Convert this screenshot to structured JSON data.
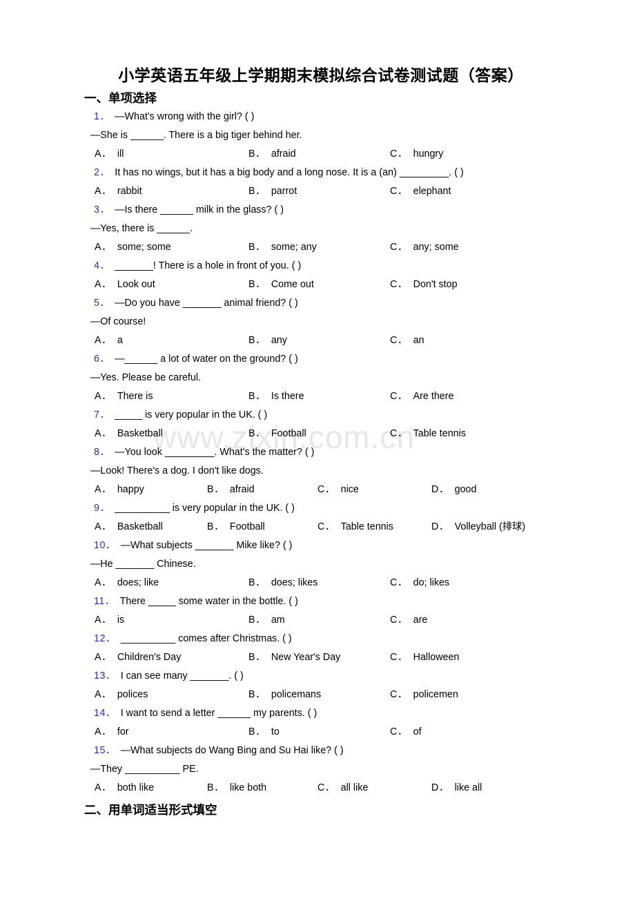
{
  "document": {
    "title": "小学英语五年级上学期期末模拟综合试卷测试题（答案）",
    "watermark": "www.zixin.com.cn",
    "accent_blue": "#2b2bc8"
  },
  "sections": [
    {
      "heading": "一、单项选择"
    },
    {
      "heading": "二、用单词适当形式填空"
    }
  ],
  "questions": [
    {
      "num": "1．",
      "stem": "—What's wrong with the girl? (    )",
      "cont": "—She is ______. There is a big tiger behind her.",
      "cols": 3,
      "options": [
        {
          "label": "A．",
          "text": "ill"
        },
        {
          "label": "B．",
          "text": "afraid"
        },
        {
          "label": "C．",
          "text": "hungry"
        }
      ]
    },
    {
      "num": "2．",
      "stem": "It has no wings, but it has a big body and a long nose. It is a (an) _________. (    )",
      "cont": "",
      "cols": 3,
      "options": [
        {
          "label": "A．",
          "text": "rabbit"
        },
        {
          "label": "B．",
          "text": "parrot"
        },
        {
          "label": "C．",
          "text": "elephant"
        }
      ]
    },
    {
      "num": "3．",
      "stem": "—Is there ______ milk in the glass? (    )",
      "cont": "—Yes, there is ______.",
      "cols": 3,
      "options": [
        {
          "label": "A．",
          "text": "some; some"
        },
        {
          "label": "B．",
          "text": "some; any"
        },
        {
          "label": "C．",
          "text": "any; some"
        }
      ]
    },
    {
      "num": "4．",
      "stem": "_______! There is a hole in front of you. (    )",
      "cont": "",
      "cols": 3,
      "options": [
        {
          "label": "A．",
          "text": "Look out"
        },
        {
          "label": "B．",
          "text": "Come out"
        },
        {
          "label": "C．",
          "text": "Don't stop"
        }
      ]
    },
    {
      "num": "5．",
      "stem": "—Do you have _______ animal friend? (    )",
      "cont": "—Of course!",
      "cols": 3,
      "options": [
        {
          "label": "A．",
          "text": "a"
        },
        {
          "label": "B．",
          "text": "any"
        },
        {
          "label": "C．",
          "text": "an"
        }
      ]
    },
    {
      "num": "6．",
      "stem": "—______ a lot of water on the ground? (    )",
      "cont": "—Yes. Please be careful.",
      "cols": 3,
      "options": [
        {
          "label": "A．",
          "text": "There is"
        },
        {
          "label": "B．",
          "text": "Is there"
        },
        {
          "label": "C．",
          "text": "Are there"
        }
      ]
    },
    {
      "num": "7．",
      "stem": "_____ is very popular in the UK. (    )",
      "cont": "",
      "cols": 3,
      "options": [
        {
          "label": "A．",
          "text": "Basketball"
        },
        {
          "label": "B．",
          "text": "Football"
        },
        {
          "label": "C．",
          "text": "Table tennis"
        }
      ]
    },
    {
      "num": "8．",
      "stem": "—You look _________. What's the matter? (    )",
      "cont": "—Look! There's a dog. I don't like dogs.",
      "cols": 4,
      "options": [
        {
          "label": "A．",
          "text": "happy"
        },
        {
          "label": "B．",
          "text": "afraid"
        },
        {
          "label": "C．",
          "text": "nice"
        },
        {
          "label": "D．",
          "text": "good"
        }
      ]
    },
    {
      "num": "9．",
      "stem": "__________ is very popular in the UK. (    )",
      "cont": "",
      "cols": 4,
      "options": [
        {
          "label": "A．",
          "text": "Basketball"
        },
        {
          "label": "B．",
          "text": "Football"
        },
        {
          "label": "C．",
          "text": "Table tennis"
        },
        {
          "label": "D．",
          "text": "Volleyball (排球)"
        }
      ]
    },
    {
      "num": "10．",
      "stem": "—What subjects _______ Mike like? (    )",
      "cont": "—He _______ Chinese.",
      "cols": 3,
      "options": [
        {
          "label": "A．",
          "text": "does; like"
        },
        {
          "label": "B．",
          "text": "does; likes"
        },
        {
          "label": "C．",
          "text": "do; likes"
        }
      ]
    },
    {
      "num": "11．",
      "stem": "There _____ some water in the bottle. (    )",
      "cont": "",
      "cols": 3,
      "options": [
        {
          "label": "A．",
          "text": "is"
        },
        {
          "label": "B．",
          "text": "am"
        },
        {
          "label": "C．",
          "text": "are"
        }
      ]
    },
    {
      "num": "12．",
      "stem": "__________ comes after Christmas. (    )",
      "cont": "",
      "cols": 3,
      "options": [
        {
          "label": "A．",
          "text": "Children's Day"
        },
        {
          "label": "B．",
          "text": "New Year's Day"
        },
        {
          "label": "C．",
          "text": "Halloween"
        }
      ]
    },
    {
      "num": "13．",
      "stem": "I can see many _______. (    )",
      "cont": "",
      "cols": 3,
      "options": [
        {
          "label": "A．",
          "text": "polices"
        },
        {
          "label": "B．",
          "text": "policemans"
        },
        {
          "label": "C．",
          "text": "policemen"
        }
      ]
    },
    {
      "num": "14．",
      "stem": "I want to send a letter ______ my parents. (    )",
      "cont": "",
      "cols": 3,
      "options": [
        {
          "label": "A．",
          "text": "for"
        },
        {
          "label": "B．",
          "text": "to"
        },
        {
          "label": "C．",
          "text": "of"
        }
      ]
    },
    {
      "num": "15．",
      "stem": "—What subjects do Wang Bing and Su Hai like? (    )",
      "cont": "—They __________ PE.",
      "cols": 4,
      "options": [
        {
          "label": "A．",
          "text": "both like"
        },
        {
          "label": "B．",
          "text": "like both"
        },
        {
          "label": "C．",
          "text": "all like"
        },
        {
          "label": "D．",
          "text": "like all"
        }
      ]
    }
  ]
}
